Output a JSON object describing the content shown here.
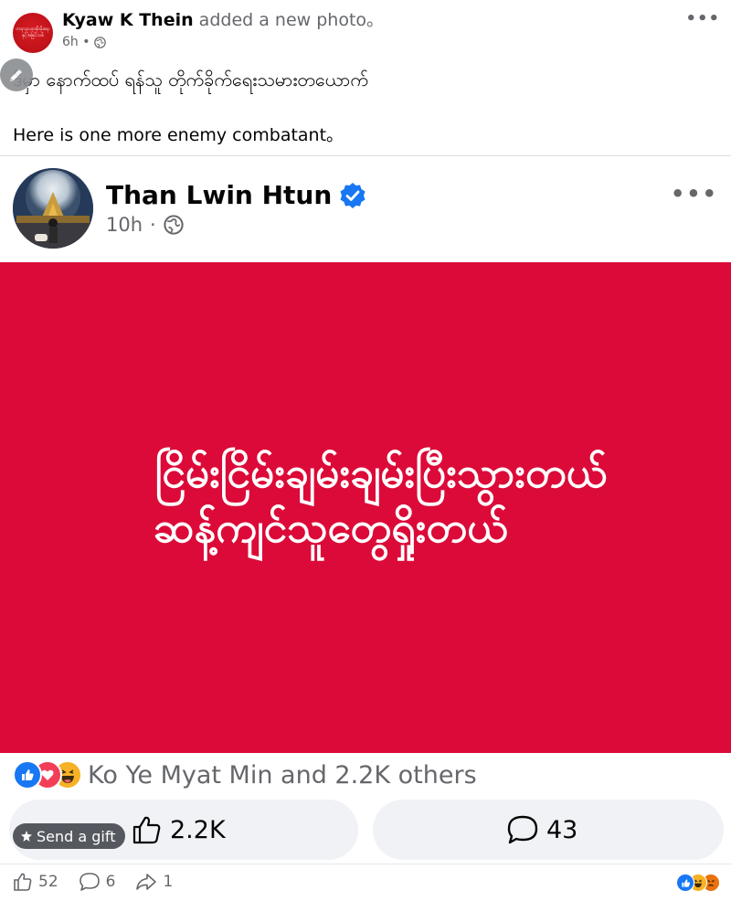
{
  "outer_post": {
    "author": "Kyaw K Thein",
    "action": " added a new photo。",
    "time": "6h •",
    "avatar_text_line1": "တရားဥပဒေစိုးမိုးရေး",
    "avatar_text_line2": "နှင့်အမြင်သစ်",
    "text_mm": "ဒီမှာ နောက်ထပ် ရန်သူ တိုက်ခိုက်ရေးသမားတယောက်",
    "text_en": "Here is one more enemy combatant。",
    "more": "•••"
  },
  "shared_post": {
    "author": "Than Lwin Htun",
    "time": "10h",
    "separator": "·",
    "more": "•••",
    "image_line1": "ငြိမ်းငြိမ်းချမ်းချမ်းပြီးသွားတယ်",
    "image_line2": "ဆန့်ကျင်သူတွေရှိုးတယ်",
    "image_bg": "#dc0a38"
  },
  "reactions": {
    "summary": "Ko Ye Myat Min and 2.2K others"
  },
  "actions": {
    "like_count": "2.2K",
    "comment_count": "43",
    "gift_label": "Send a gift"
  },
  "bottom_bar": {
    "likes": "52",
    "comments": "6",
    "shares": "1"
  },
  "colors": {
    "facebook_blue": "#1877f2",
    "secondary_text": "#65676b",
    "pill_bg": "#f0f2f5"
  }
}
